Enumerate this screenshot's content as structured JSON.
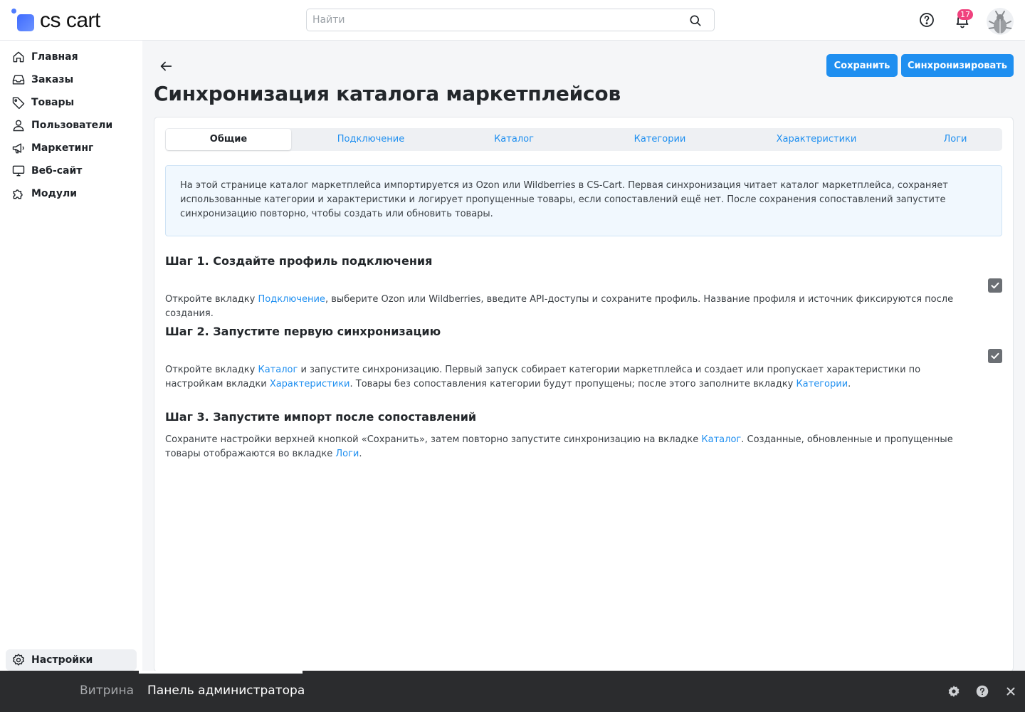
{
  "header": {
    "logo_text": "cs cart",
    "search_placeholder": "Найти",
    "notifications_count": "17"
  },
  "sidebar": {
    "items": [
      {
        "label": "Главная",
        "icon": "home-icon"
      },
      {
        "label": "Заказы",
        "icon": "inbox-icon"
      },
      {
        "label": "Товары",
        "icon": "tag-icon"
      },
      {
        "label": "Пользователи",
        "icon": "user-icon"
      },
      {
        "label": "Маркетинг",
        "icon": "megaphone-icon"
      },
      {
        "label": "Веб-сайт",
        "icon": "monitor-icon"
      },
      {
        "label": "Модули",
        "icon": "puzzle-icon"
      }
    ],
    "settings_label": "Настройки"
  },
  "toolbar": {
    "save_label": "Сохранить",
    "sync_label": "Синхронизировать"
  },
  "page": {
    "title": "Синхронизация каталога маркетплейсов"
  },
  "tabs": [
    {
      "label": "Общие",
      "active": true
    },
    {
      "label": "Подключение",
      "active": false
    },
    {
      "label": "Каталог",
      "active": false
    },
    {
      "label": "Категории",
      "active": false
    },
    {
      "label": "Характеристики",
      "active": false
    },
    {
      "label": "Логи",
      "active": false
    }
  ],
  "info": {
    "text": "На этой странице каталог маркетплейса импортируется из Ozon или Wildberries в CS-Cart. Первая синхронизация читает каталог маркетплейса, сохраняет использованные категории и характеристики и логирует пропущенные товары, если сопоставлений ещё нет. После сохранения сопоставлений запустите синхронизацию повторно, чтобы создать или обновить товары."
  },
  "steps": {
    "s1": {
      "title": "Шаг 1. Создайте профиль подключения",
      "t1": "Откройте вкладку ",
      "l1": "Подключение",
      "t2": ", выберите Ozon или Wildberries, введите API-доступы и сохраните профиль. Название профиля и источник фиксируются после создания.",
      "checked": true
    },
    "s2": {
      "title": "Шаг 2. Запустите первую синхронизацию",
      "t1": "Откройте вкладку ",
      "l1": "Каталог",
      "t2": " и запустите синхронизацию. Первый запуск собирает категории маркетплейса и создает или пропускает характеристики по настройкам вкладки ",
      "l2": "Характеристики",
      "t3": ". Товары без сопоставления категории будут пропущены; после этого заполните вкладку ",
      "l3": "Категории",
      "t4": ".",
      "checked": true
    },
    "s3": {
      "title": "Шаг 3. Запустите импорт после сопоставлений",
      "t1": "Сохраните настройки верхней кнопкой «Сохранить», затем повторно запустите синхронизацию на вкладке ",
      "l1": "Каталог",
      "t2": ". Созданные, обновленные и пропущенные товары отображаются во вкладке ",
      "l2": "Логи",
      "t3": "."
    }
  },
  "bottombar": {
    "storefront_label": "Витрина",
    "admin_label": "Панель администратора"
  },
  "colors": {
    "accent": "#1f8ff0",
    "badge": "#f0427e",
    "bottombar": "#2b2c2e",
    "info_bg": "#f1f8fe"
  }
}
